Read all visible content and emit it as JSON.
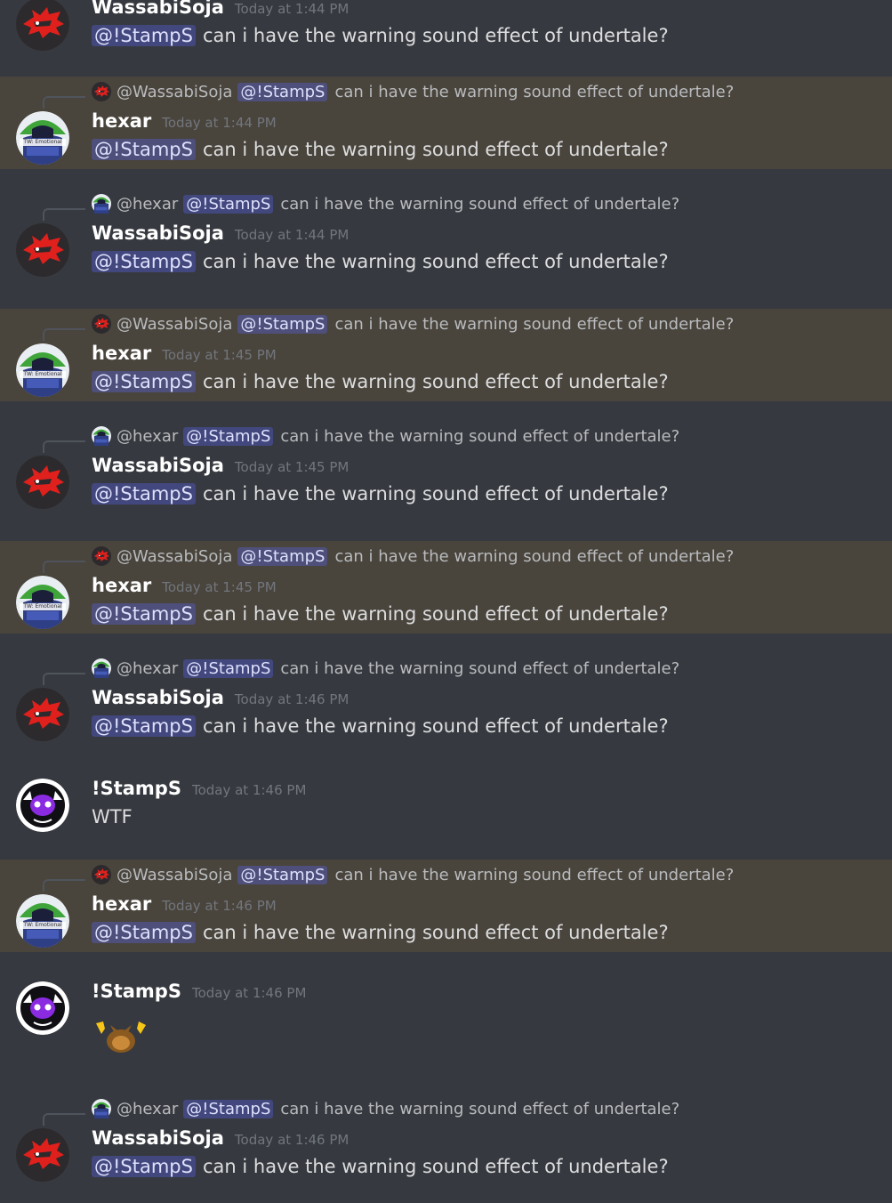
{
  "colors": {
    "background": "#36393f",
    "highlight_background": "#49443c",
    "mention_background": "#414675",
    "mention_text": "#dee0fc",
    "username": "#ffffff",
    "timestamp": "#72767d",
    "message_text": "#dcddde"
  },
  "messages": [
    {
      "author": "WassabiSoja",
      "avatar": "wassabi-red-dragon-avatar",
      "timestamp": "Today at 1:44 PM",
      "mention": "@!StampS",
      "text": "can i have the warning sound effect of undertale?"
    },
    {
      "highlighted": true,
      "reply_to": {
        "author": "@WassabiSoja",
        "avatar": "wassabi-red-dragon-avatar",
        "mention": "@!StampS",
        "text": "can i have the warning sound effect of undertale?"
      },
      "author": "hexar",
      "avatar": "hexar-avatar",
      "avatar_caption": "TW: Emotional",
      "timestamp": "Today at 1:44 PM",
      "mention": "@!StampS",
      "text": "can i have the warning sound effect of undertale?"
    },
    {
      "reply_to": {
        "author": "@hexar",
        "avatar": "hexar-avatar",
        "mention": "@!StampS",
        "text": "can i have the warning sound effect of undertale?"
      },
      "author": "WassabiSoja",
      "avatar": "wassabi-red-dragon-avatar",
      "timestamp": "Today at 1:44 PM",
      "mention": "@!StampS",
      "text": "can i have the warning sound effect of undertale?"
    },
    {
      "highlighted": true,
      "reply_to": {
        "author": "@WassabiSoja",
        "avatar": "wassabi-red-dragon-avatar",
        "mention": "@!StampS",
        "text": "can i have the warning sound effect of undertale?"
      },
      "author": "hexar",
      "avatar": "hexar-avatar",
      "avatar_caption": "TW: Emotional",
      "timestamp": "Today at 1:45 PM",
      "mention": "@!StampS",
      "text": "can i have the warning sound effect of undertale?"
    },
    {
      "reply_to": {
        "author": "@hexar",
        "avatar": "hexar-avatar",
        "mention": "@!StampS",
        "text": "can i have the warning sound effect of undertale?"
      },
      "author": "WassabiSoja",
      "avatar": "wassabi-red-dragon-avatar",
      "timestamp": "Today at 1:45 PM",
      "mention": "@!StampS",
      "text": "can i have the warning sound effect of undertale?"
    },
    {
      "highlighted": true,
      "reply_to": {
        "author": "@WassabiSoja",
        "avatar": "wassabi-red-dragon-avatar",
        "mention": "@!StampS",
        "text": "can i have the warning sound effect of undertale?"
      },
      "author": "hexar",
      "avatar": "hexar-avatar",
      "avatar_caption": "TW: Emotional",
      "timestamp": "Today at 1:45 PM",
      "mention": "@!StampS",
      "text": "can i have the warning sound effect of undertale?"
    },
    {
      "reply_to": {
        "author": "@hexar",
        "avatar": "hexar-avatar",
        "mention": "@!StampS",
        "text": "can i have the warning sound effect of undertale?"
      },
      "author": "WassabiSoja",
      "avatar": "wassabi-red-dragon-avatar",
      "timestamp": "Today at 1:46 PM",
      "mention": "@!StampS",
      "text": "can i have the warning sound effect of undertale?"
    },
    {
      "author": "!StampS",
      "avatar": "stamps-purple-creature-avatar",
      "timestamp": "Today at 1:46 PM",
      "text": "WTF"
    },
    {
      "highlighted": true,
      "reply_to": {
        "author": "@WassabiSoja",
        "avatar": "wassabi-red-dragon-avatar",
        "mention": "@!StampS",
        "text": "can i have the warning sound effect of undertale?"
      },
      "author": "hexar",
      "avatar": "hexar-avatar",
      "avatar_caption": "TW: Emotional",
      "timestamp": "Today at 1:46 PM",
      "mention": "@!StampS",
      "text": "can i have the warning sound effect of undertale?"
    },
    {
      "author": "!StampS",
      "avatar": "stamps-purple-creature-avatar",
      "timestamp": "Today at 1:46 PM",
      "emoji": "raised-hands-creature-emoji"
    },
    {
      "reply_to": {
        "author": "@hexar",
        "avatar": "hexar-avatar",
        "mention": "@!StampS",
        "text": "can i have the warning sound effect of undertale?"
      },
      "author": "WassabiSoja",
      "avatar": "wassabi-red-dragon-avatar",
      "timestamp": "Today at 1:46 PM",
      "mention": "@!StampS",
      "text": "can i have the warning sound effect of undertale?"
    }
  ]
}
